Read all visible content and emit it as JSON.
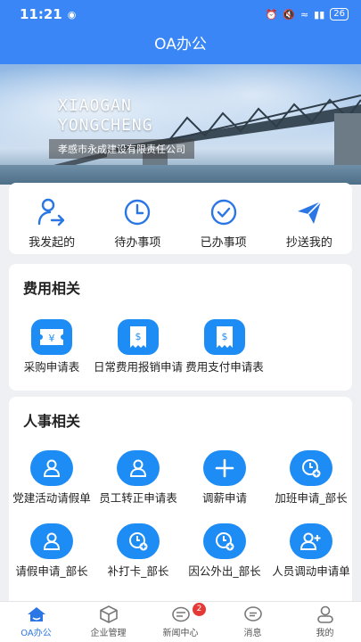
{
  "status_bar": {
    "time": "11:21",
    "battery": "26"
  },
  "app_title": "OA办公",
  "banner": {
    "title_line1": "XIAOGAN",
    "title_line2": "YONGCHENG",
    "company": "孝感市永成建设有限责任公司"
  },
  "quick_actions": [
    {
      "label": "我发起的",
      "icon": "user-send-icon"
    },
    {
      "label": "待办事项",
      "icon": "clock-icon"
    },
    {
      "label": "已办事项",
      "icon": "check-circle-icon"
    },
    {
      "label": "抄送我的",
      "icon": "paper-plane-icon"
    }
  ],
  "expense": {
    "title": "费用相关",
    "items": [
      {
        "label": "采购申请表",
        "icon": "yen-ticket-icon"
      },
      {
        "label": "日常费用报销申请",
        "icon": "dollar-receipt-icon"
      },
      {
        "label": "费用支付申请表",
        "icon": "dollar-receipt-icon"
      }
    ]
  },
  "hr": {
    "title": "人事相关",
    "items": [
      {
        "label": "党建活动请假单",
        "icon": "person-icon"
      },
      {
        "label": "员工转正申请表",
        "icon": "person-icon"
      },
      {
        "label": "调薪申请",
        "icon": "plus-icon"
      },
      {
        "label": "加班申请_部长",
        "icon": "clock-plus-icon"
      },
      {
        "label": "请假申请_部长",
        "icon": "person-icon"
      },
      {
        "label": "补打卡_部长",
        "icon": "clock-plus-icon"
      },
      {
        "label": "因公外出_部长",
        "icon": "clock-plus-icon"
      },
      {
        "label": "人员调动申请单",
        "icon": "person-add-icon"
      }
    ]
  },
  "tabs": [
    {
      "label": "OA办公",
      "icon": "home-icon"
    },
    {
      "label": "企业管理",
      "icon": "cube-icon"
    },
    {
      "label": "新闻中心",
      "icon": "news-icon",
      "badge": "2"
    },
    {
      "label": "消息",
      "icon": "chat-icon"
    },
    {
      "label": "我的",
      "icon": "profile-icon"
    }
  ]
}
